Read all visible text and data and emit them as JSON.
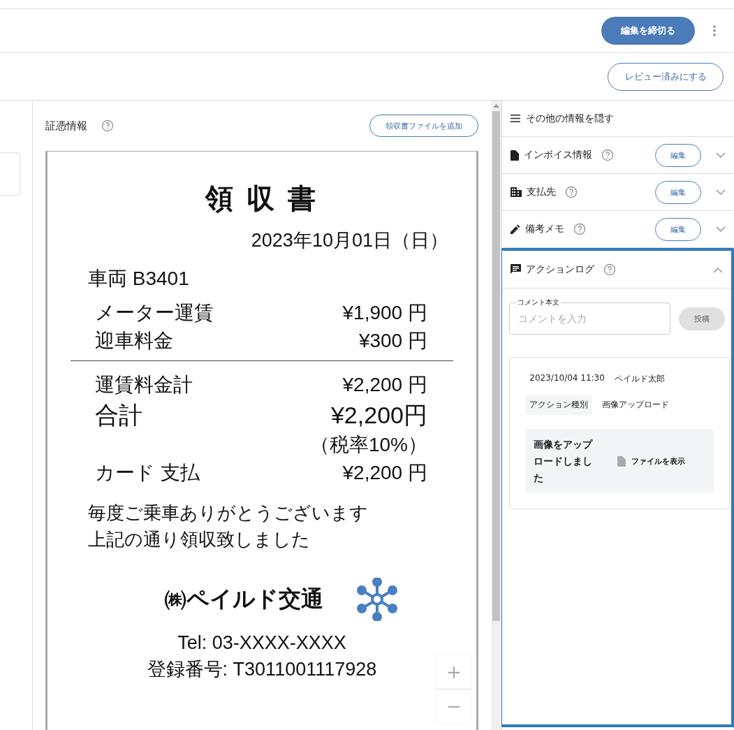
{
  "header": {
    "close_button": "編集を締切る"
  },
  "review_button": "レビュー済みにする",
  "evidence": {
    "title": "証憑情報",
    "add_button": "領収書ファイルを追加",
    "receipt": {
      "title": "領 収 書",
      "date": "2023年10月01日（日）",
      "vehicle": "車両 B3401",
      "items": [
        {
          "kind": "item",
          "label": "メーター運賃",
          "value": "¥1,900 円"
        },
        {
          "kind": "item",
          "label": "迎車料金",
          "value": "¥300 円"
        }
      ],
      "totals": [
        {
          "kind": "item",
          "label": "運賃料金計",
          "value": "¥2,200 円"
        },
        {
          "kind": "total",
          "label": "合計",
          "value": "¥2,200円"
        },
        {
          "kind": "note",
          "value": "（税率10%）"
        },
        {
          "kind": "item",
          "label": "カード 支払",
          "value": "¥2,200 円"
        }
      ],
      "message": [
        "毎度ご乗車ありがとうございます",
        "上記の通り領収致しました"
      ],
      "company": "㈱ペイルド交通",
      "tel": "Tel: 03-XXXX-XXXX",
      "registration": "登録番号: T3011001117928"
    },
    "zoom": {
      "plus": "+",
      "minus": "−"
    }
  },
  "side": {
    "toggle": "その他の情報を隠す",
    "sections": [
      {
        "kind": "document",
        "title": "インボイス情報",
        "edit_button": "編集",
        "expanded": false
      },
      {
        "kind": "building",
        "title": "支払先",
        "edit_button": "編集",
        "expanded": false
      },
      {
        "kind": "pencil",
        "title": "備考メモ",
        "edit_button": "編集",
        "expanded": false
      }
    ],
    "action_log": {
      "title": "アクションログ",
      "expanded": true,
      "selected": true,
      "comment_label": "コメント本文",
      "comment_placeholder": "コメントを入力",
      "post_button": "投稿",
      "post_disabled": true,
      "entries": [
        {
          "datetime": "2023/10/04 11:30",
          "user": "ペイルド太郎",
          "type_label": "アクション種別",
          "type_value": "画像アップロード",
          "message": "画像をアップロードしました",
          "file_link": "ファイルを表示"
        }
      ]
    }
  }
}
